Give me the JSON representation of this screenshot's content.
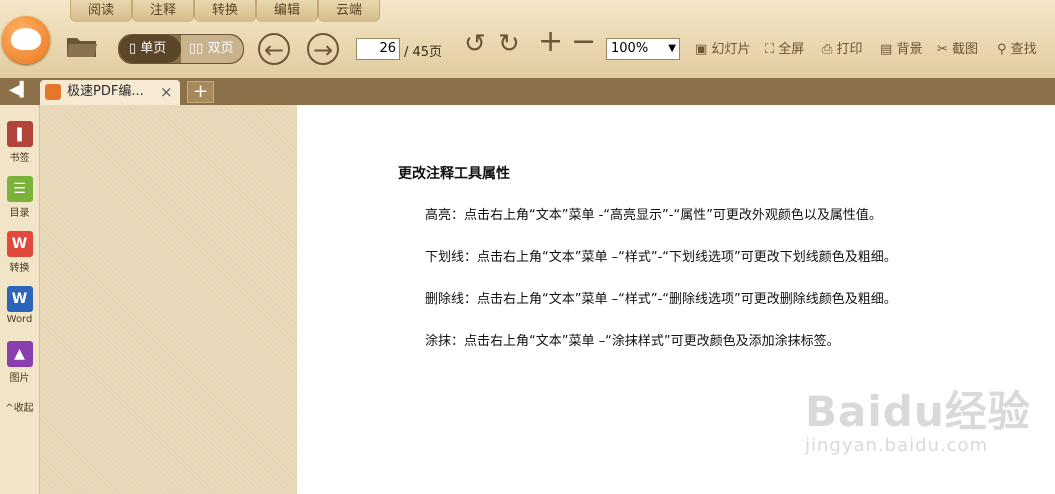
{
  "menu_tabs": [
    "阅读",
    "注释",
    "转换",
    "编辑",
    "云端"
  ],
  "toolbar": {
    "single_page": "单页",
    "double_page": "双页",
    "page_current": "26",
    "page_total": "/ 45页",
    "zoom": "100%",
    "slideshow": "幻灯片",
    "fullscreen": "全屏",
    "print": "打印",
    "background": "背景",
    "screenshot": "截图",
    "find": "查找"
  },
  "tabs": {
    "doc_tab_label": "极速PDF编...",
    "close_symbol": "×",
    "add_symbol": "+"
  },
  "sidebar": {
    "items": [
      {
        "label": "书签",
        "icon": "bookmark-icon",
        "color": "#b2443a"
      },
      {
        "label": "目录",
        "icon": "toc-icon",
        "color": "#7bb33a"
      },
      {
        "label": "转换",
        "icon": "convert-icon",
        "color": "#e2483b"
      },
      {
        "label": "Word",
        "icon": "word-icon",
        "color": "#2b64b8"
      },
      {
        "label": "图片",
        "icon": "image-icon",
        "color": "#8a3fb0"
      }
    ],
    "collapse": "收起"
  },
  "document": {
    "title": "更改注释工具属性",
    "lines": [
      "高亮：点击右上角“文本”菜单 -“高亮显示”-“属性”可更改外观颜色以及属性值。",
      "下划线：点击右上角“文本”菜单 –“样式”-“下划线选项”可更改下划线颜色及粗细。",
      "删除线：点击右上角“文本”菜单 –“样式”-“删除线选项”可更改删除线颜色及粗细。",
      "涂抹：点击右上角“文本”菜单 –“涂抹样式”可更改颜色及添加涂抹标签。"
    ]
  },
  "watermark": {
    "main": "Baidu经验",
    "sub": "jingyan.baidu.com"
  }
}
